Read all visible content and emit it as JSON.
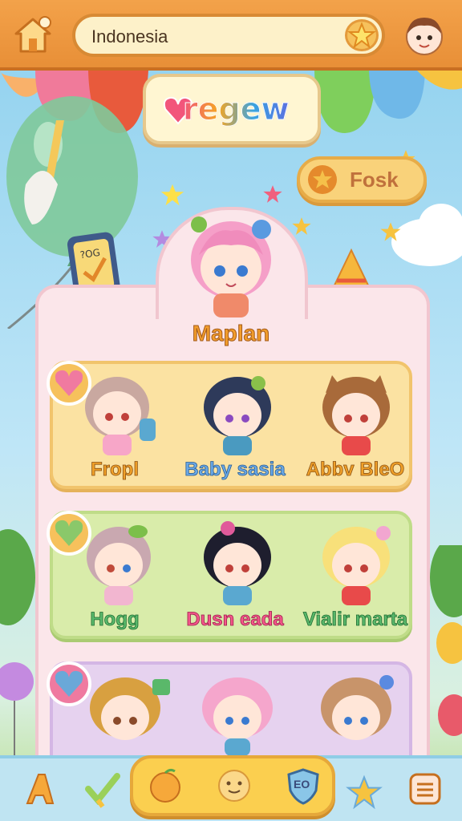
{
  "header": {
    "search_value": "Indonesia"
  },
  "logo": {
    "text": "regew"
  },
  "fosk_button": {
    "label": "Fosk"
  },
  "featured": {
    "name": "Maplan"
  },
  "rows": [
    {
      "characters": [
        "Fropl",
        "Baby sasia",
        "Abbv BleO"
      ]
    },
    {
      "characters": [
        "Hogg",
        "Dusn eada",
        "Vialir marta"
      ]
    },
    {
      "characters": [
        "",
        "",
        ""
      ]
    }
  ],
  "device_sign": {
    "text": "?OG"
  },
  "bottom_nav": {
    "badge_label": "EO"
  },
  "icons": {
    "home": "home-icon",
    "search_star": "star-icon",
    "profile": "avatar-icon",
    "nav": [
      "letter-a-icon",
      "checkmark-icon",
      "orange-icon",
      "smile-icon",
      "shield-icon",
      "star-icon",
      "menu-icon"
    ]
  },
  "colors": {
    "topbar": "#f3a24a",
    "row1": "#fbe2a2",
    "row2": "#d9ecaa",
    "row3": "#e6d2ef",
    "panel": "#fbe6ea",
    "accent_yellow": "#fbcf4f"
  }
}
